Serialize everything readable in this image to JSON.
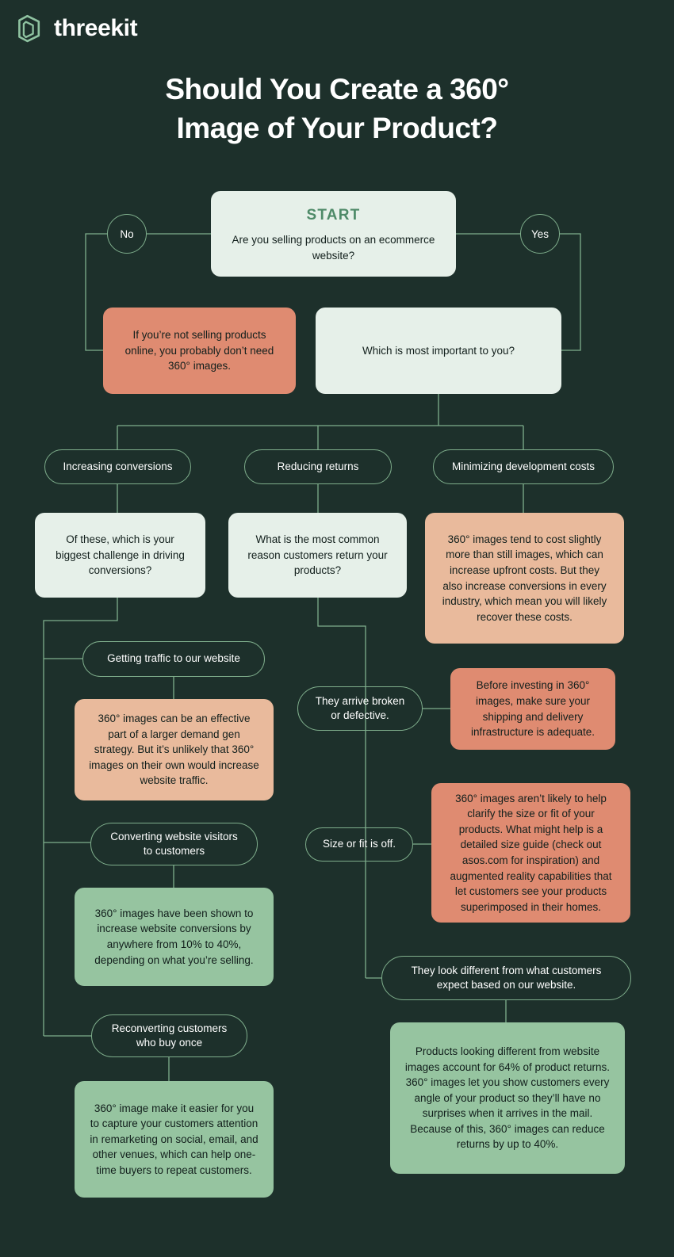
{
  "brand": {
    "name": "threekit",
    "logo_icon": "threekit-cube-logo"
  },
  "title": {
    "line1": "Should You Create a 360°",
    "line2": "Image of Your Product?"
  },
  "colors": {
    "background": "#1d302b",
    "connector": "#7fae8c",
    "cream": "#e6f0e9",
    "salmon": "#df8b71",
    "peach": "#e9ba9c",
    "mint": "#96c4a0",
    "start_accent": "#4e8a68",
    "text_light": "#ffffff",
    "text_dark": "#121f1c"
  },
  "flow": {
    "start": {
      "label": "START",
      "question": "Are you selling products on an ecommerce website?"
    },
    "branch_no": "No",
    "branch_yes": "Yes",
    "no_outcome": "If you’re not selling products online, you probably don’t need 360° images.",
    "priority_question": "Which is most important to you?",
    "priorities": [
      "Increasing conversions",
      "Reducing returns",
      "Minimizing development costs"
    ],
    "conversions_question": "Of these, which is your biggest challenge in driving conversions?",
    "returns_question": "What is the most common reason customers return your products?",
    "dev_costs_answer": "360° images tend to cost slightly more than still images, which can increase upfront costs. But they also increase conversions in every industry, which mean you will likely recover these costs.",
    "conversion_options": [
      {
        "label": "Getting traffic to our website",
        "answer": "360° images can be an effective part of a larger demand gen strategy. But it’s unlikely that 360° images on their own would increase website traffic."
      },
      {
        "label": "Converting website visitors to customers",
        "answer": "360° images have been shown to increase website conversions by anywhere from 10% to 40%, depending on what you’re selling."
      },
      {
        "label": "Reconverting customers who buy once",
        "answer": "360° image make it easier for you to capture your customers attention in remarketing on social, email, and other venues, which can help one-time buyers to repeat customers."
      }
    ],
    "return_options": [
      {
        "label": "They arrive broken or defective.",
        "answer": "Before investing in 360° images, make sure your shipping and delivery infrastructure is adequate."
      },
      {
        "label": "Size or fit is off.",
        "answer": "360° images aren’t likely to help clarify the size or fit of your products. What might help is a detailed size guide (check out asos.com for inspiration) and augmented reality capabilities that let customers see your products superimposed in their homes."
      },
      {
        "label": "They look different from what customers expect based on our website.",
        "answer": "Products looking different from website images account for 64% of product returns. 360° images let you show customers every angle of your product so they’ll have no surprises when it arrives in the mail. Because of this, 360° images can reduce returns by up to 40%."
      }
    ]
  }
}
